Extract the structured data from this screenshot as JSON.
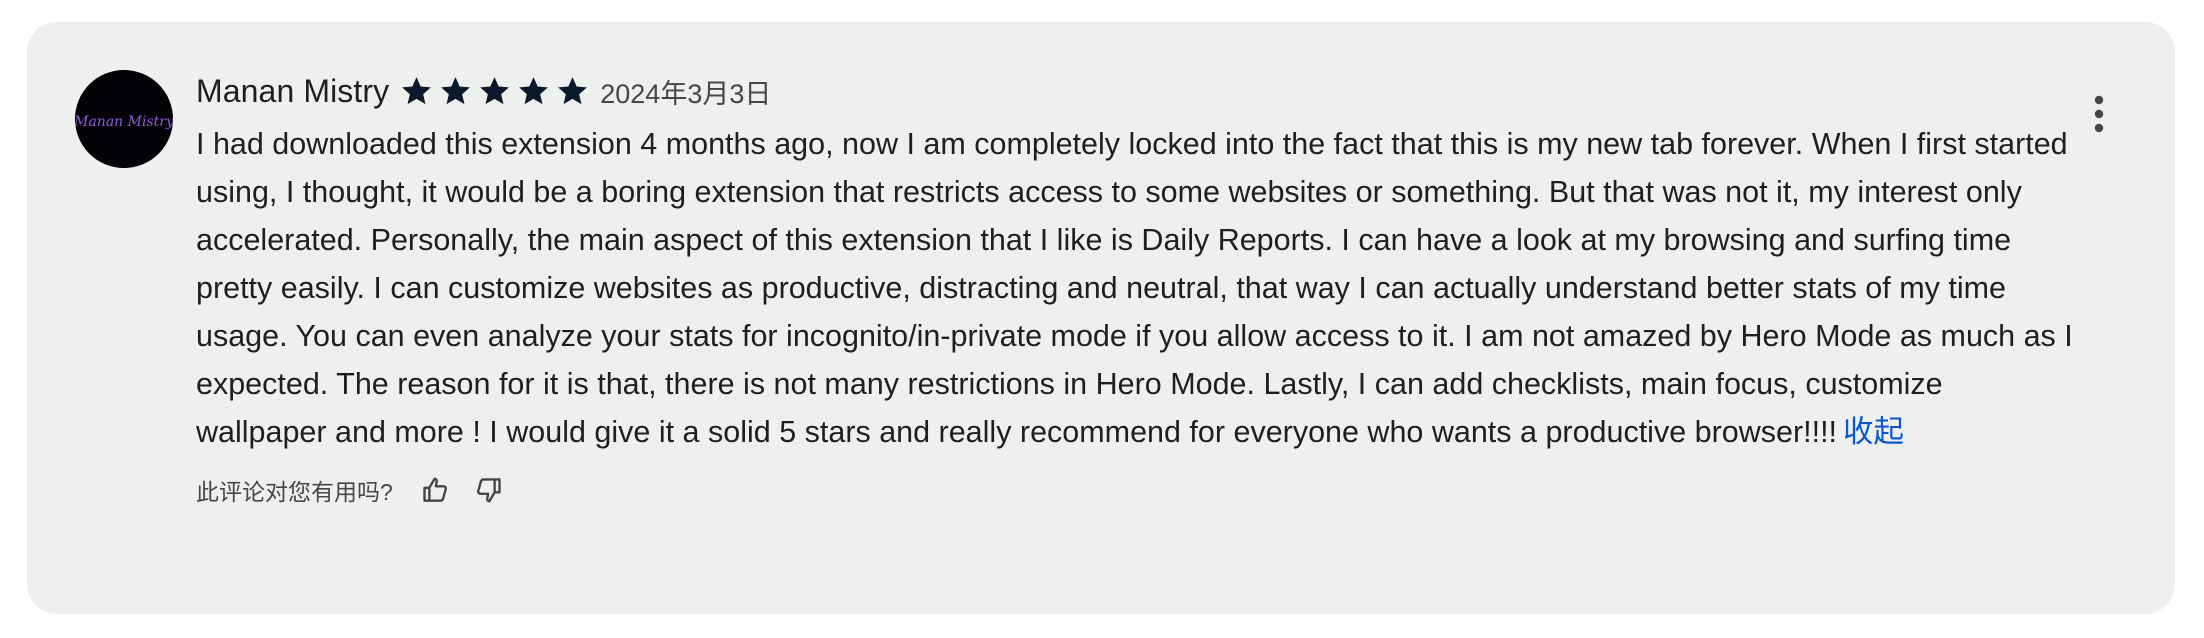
{
  "review": {
    "author": "Manan Mistry",
    "avatar_text": "Manan Mistry",
    "rating": 5,
    "rating_max": 5,
    "date": "2024年3月3日",
    "text": "I had downloaded this extension 4 months ago, now I am completely locked into the fact that this is my new tab forever. When I first started using, I thought, it would be a boring extension that restricts access to some websites or something. But that was not it, my interest only accelerated. Personally, the main aspect of this extension that I like is Daily Reports. I can have a look at my browsing and surfing time pretty easily. I can customize websites as productive, distracting and neutral, that way I can actually understand better stats of my time usage. You can even analyze your stats for incognito/in-private mode if you allow access to it. I am not amazed by Hero Mode as much as I expected. The reason for it is that, there is not many restrictions in Hero Mode. Lastly, I can add checklists, main focus, customize wallpaper and more ! I would give it a solid 5 stars and really recommend for everyone who wants a productive browser!!!!",
    "collapse_label": "收起",
    "helpful_prompt": "此评论对您有用吗?"
  },
  "icons": {
    "star": "star-icon",
    "thumb_up": "thumb-up-icon",
    "thumb_down": "thumb-down-icon",
    "more": "more-vert-icon"
  },
  "colors": {
    "card_bg": "#eef0ed",
    "star": "#0b1a2b",
    "link": "#0b57d0",
    "text": "#1f1f1f",
    "secondary_text": "#444746"
  }
}
